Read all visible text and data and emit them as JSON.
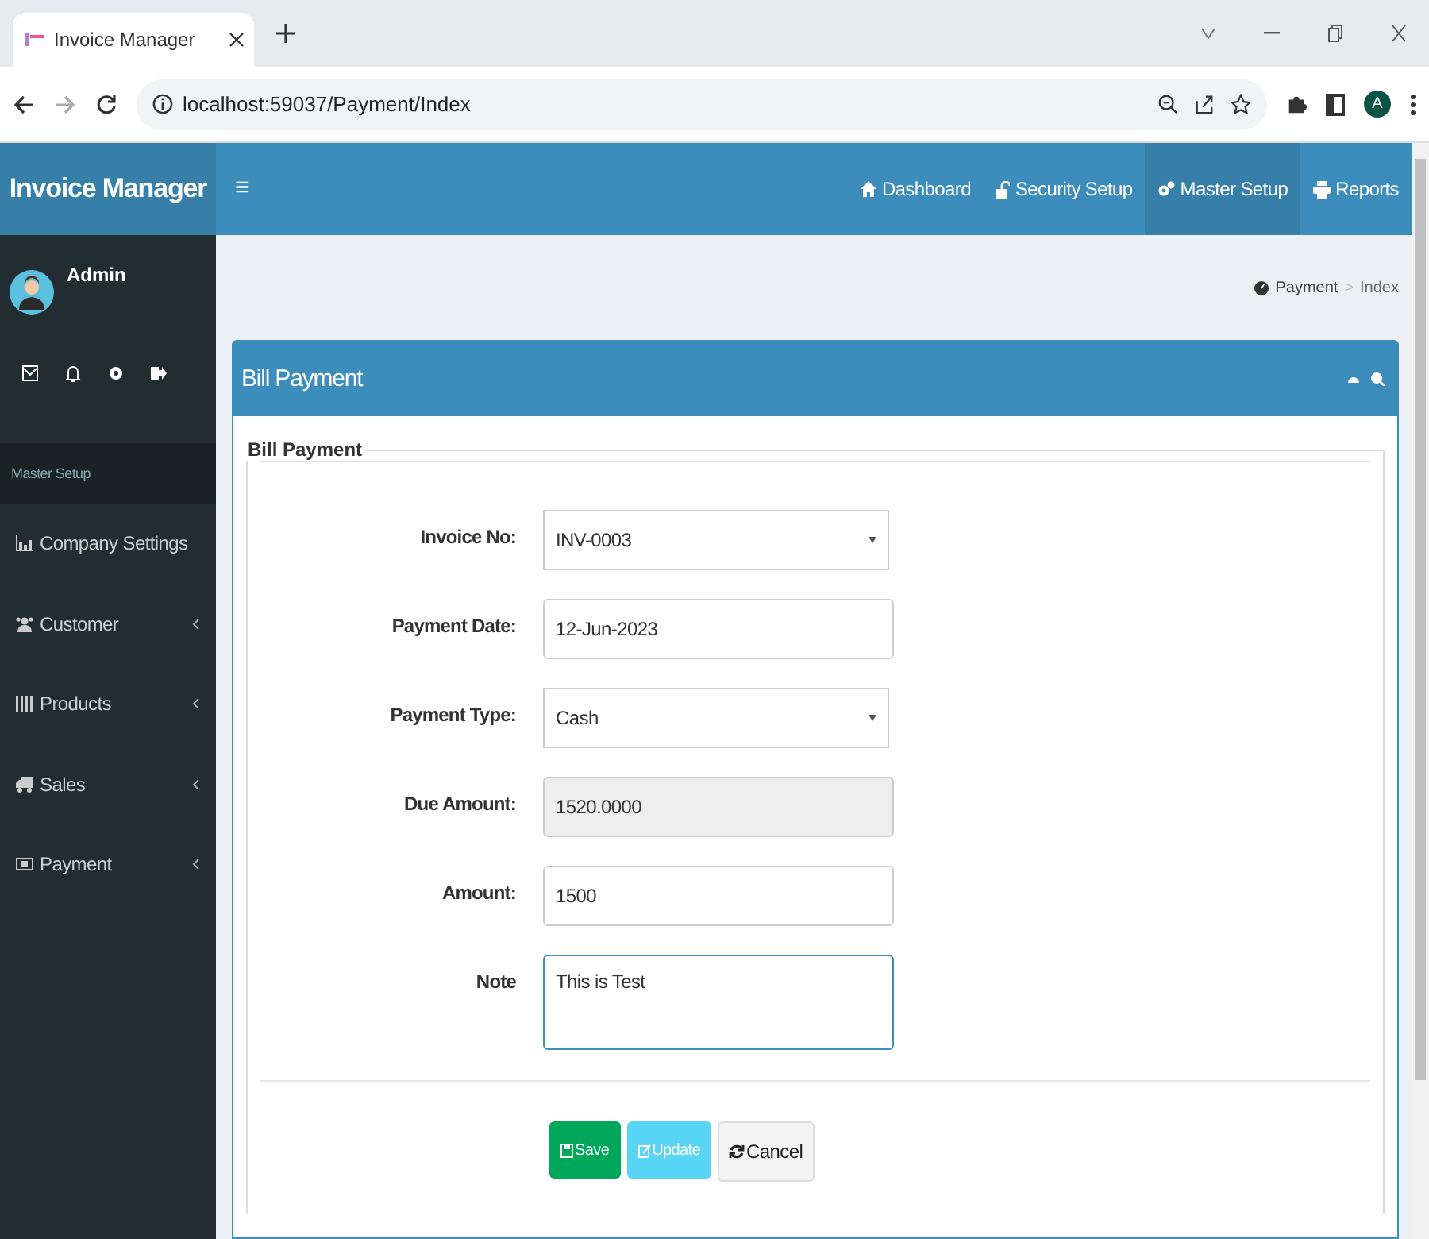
{
  "browser": {
    "tab_title": "Invoice Manager",
    "url": "localhost:59037/Payment/Index",
    "profile_initial": "A"
  },
  "app": {
    "brand": "Invoice Manager",
    "menu_glyph": "≡",
    "nav": [
      {
        "label": "Dashboard",
        "selected": false
      },
      {
        "label": "Security Setup",
        "selected": false
      },
      {
        "label": "Master Setup",
        "selected": true
      },
      {
        "label": "Reports",
        "selected": false
      }
    ]
  },
  "sidebar": {
    "user": "Admin",
    "section": "Master Setup",
    "items": [
      {
        "label": "Company Settings",
        "has_submenu": false
      },
      {
        "label": "Customer",
        "has_submenu": true
      },
      {
        "label": "Products",
        "has_submenu": true
      },
      {
        "label": "Sales",
        "has_submenu": true
      },
      {
        "label": "Payment",
        "has_submenu": true
      }
    ]
  },
  "breadcrumb": [
    "Payment",
    "Index"
  ],
  "breadcrumb_separator": ">",
  "panel": {
    "title": "Bill Payment",
    "legend": "Bill Payment",
    "fields": [
      {
        "label": "Invoice No:",
        "kind": "select",
        "value": "INV-0003"
      },
      {
        "label": "Payment Date:",
        "kind": "text",
        "value": "12-Jun-2023"
      },
      {
        "label": "Payment Type:",
        "kind": "select",
        "value": "Cash"
      },
      {
        "label": "Due Amount:",
        "kind": "readonly",
        "value": "1520.0000"
      },
      {
        "label": "Amount:",
        "kind": "text",
        "value": "1500"
      },
      {
        "label": "Note",
        "kind": "textarea",
        "value": "This is Test"
      }
    ],
    "buttons": [
      {
        "label": "Save",
        "kind": "save",
        "disabled": false
      },
      {
        "label": "Update",
        "kind": "update",
        "disabled": true
      },
      {
        "label": "Cancel",
        "kind": "cancel",
        "disabled": false
      }
    ]
  }
}
